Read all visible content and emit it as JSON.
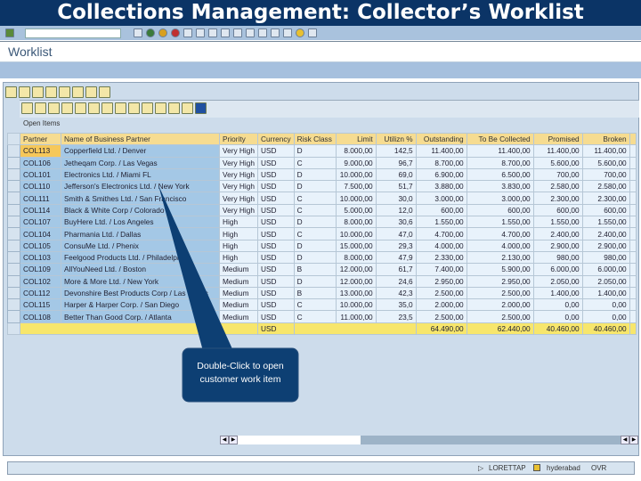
{
  "title": "Collections Management: Collector’s Worklist",
  "screen_title": "Worklist",
  "open_items_label": "Open Items",
  "columns": [
    "Partner",
    "Name of Business Partner",
    "Priority",
    "Currency",
    "Risk Class",
    "Limit",
    "Utilizn %",
    "Outstanding",
    "To Be Collected",
    "Promised",
    "Broken"
  ],
  "rows": [
    [
      "COL113",
      "Copperfield Ltd. / Denver",
      "Very High",
      "USD",
      "D",
      "8.000,00",
      "142,5",
      "11.400,00",
      "11.400,00",
      "11.400,00",
      "11.400,00"
    ],
    [
      "COL106",
      "Jetheqam Corp. / Las Vegas",
      "Very High",
      "USD",
      "C",
      "9.000,00",
      "96,7",
      "8.700,00",
      "8.700,00",
      "5.600,00",
      "5.600,00"
    ],
    [
      "COL101",
      "Electronics Ltd. / Miami FL",
      "Very High",
      "USD",
      "D",
      "10.000,00",
      "69,0",
      "6.900,00",
      "6.500,00",
      "700,00",
      "700,00"
    ],
    [
      "COL110",
      "Jefferson's Electronics Ltd. / New York",
      "Very High",
      "USD",
      "D",
      "7.500,00",
      "51,7",
      "3.880,00",
      "3.830,00",
      "2.580,00",
      "2.580,00"
    ],
    [
      "COL111",
      "Smith & Smithes Ltd. / San Francisco",
      "Very High",
      "USD",
      "C",
      "10.000,00",
      "30,0",
      "3.000,00",
      "3.000,00",
      "2.300,00",
      "2.300,00"
    ],
    [
      "COL114",
      "Black & White Corp / Colorado",
      "Very High",
      "USD",
      "C",
      "5.000,00",
      "12,0",
      "600,00",
      "600,00",
      "600,00",
      "600,00"
    ],
    [
      "COL107",
      "BuyHere Ltd. / Los Angeles",
      "High",
      "USD",
      "D",
      "8.000,00",
      "30,6",
      "1.550,00",
      "1.550,00",
      "1.550,00",
      "1.550,00"
    ],
    [
      "COL104",
      "Pharmania Ltd. / Dallas",
      "High",
      "USD",
      "C",
      "10.000,00",
      "47,0",
      "4.700,00",
      "4.700,00",
      "2.400,00",
      "2.400,00"
    ],
    [
      "COL105",
      "ConsuMe Ltd. / Phenix",
      "High",
      "USD",
      "D",
      "15.000,00",
      "29,3",
      "4.000,00",
      "4.000,00",
      "2.900,00",
      "2.900,00"
    ],
    [
      "COL103",
      "Feelgood Products Ltd. / Philadelphia",
      "High",
      "USD",
      "D",
      "8.000,00",
      "47,9",
      "2.330,00",
      "2.130,00",
      "980,00",
      "980,00"
    ],
    [
      "COL109",
      "AllYouNeed Ltd. / Boston",
      "Medium",
      "USD",
      "B",
      "12.000,00",
      "61,7",
      "7.400,00",
      "5.900,00",
      "6.000,00",
      "6.000,00"
    ],
    [
      "COL102",
      "More & More Ltd. / New York",
      "Medium",
      "USD",
      "D",
      "12.000,00",
      "24,6",
      "2.950,00",
      "2.950,00",
      "2.050,00",
      "2.050,00"
    ],
    [
      "COL112",
      "Devonshire Best Products Corp / Las Vegas",
      "Medium",
      "USD",
      "B",
      "13.000,00",
      "42,3",
      "2.500,00",
      "2.500,00",
      "1.400,00",
      "1.400,00"
    ],
    [
      "COL115",
      "Harper & Harper Corp. / San Diego",
      "Medium",
      "USD",
      "C",
      "10.000,00",
      "35,0",
      "2.000,00",
      "2.000,00",
      "0,00",
      "0,00"
    ],
    [
      "COL108",
      "Better Than Good Corp. / Atlanta",
      "Medium",
      "USD",
      "C",
      "11.000,00",
      "23,5",
      "2.500,00",
      "2.500,00",
      "0,00",
      "0,00"
    ]
  ],
  "totals": {
    "currency": "USD",
    "outstanding": "64.490,00",
    "to_be_collected": "62.440,00",
    "promised": "40.460,00",
    "broken": "40.460,00"
  },
  "callout": "Double-Click to open customer work item",
  "status": {
    "user": "LORETTAP",
    "server": "hyderabad",
    "mode": "OVR"
  }
}
